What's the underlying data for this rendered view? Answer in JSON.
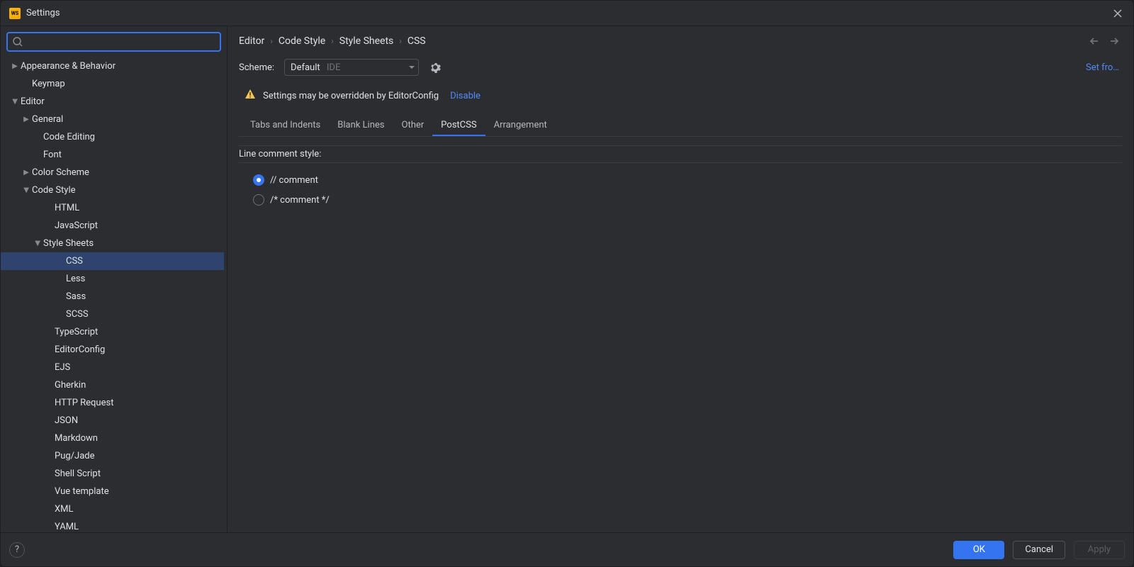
{
  "title": "Settings",
  "search_placeholder": "",
  "tree": [
    {
      "label": "Appearance & Behavior",
      "indent": 12,
      "arrow": "collapsed"
    },
    {
      "label": "Keymap",
      "indent": 28,
      "arrow": "none"
    },
    {
      "label": "Editor",
      "indent": 12,
      "arrow": "expanded"
    },
    {
      "label": "General",
      "indent": 28,
      "arrow": "collapsed"
    },
    {
      "label": "Code Editing",
      "indent": 44,
      "arrow": "none"
    },
    {
      "label": "Font",
      "indent": 44,
      "arrow": "none"
    },
    {
      "label": "Color Scheme",
      "indent": 28,
      "arrow": "collapsed"
    },
    {
      "label": "Code Style",
      "indent": 28,
      "arrow": "expanded"
    },
    {
      "label": "HTML",
      "indent": 60,
      "arrow": "none"
    },
    {
      "label": "JavaScript",
      "indent": 60,
      "arrow": "none"
    },
    {
      "label": "Style Sheets",
      "indent": 44,
      "arrow": "expanded"
    },
    {
      "label": "CSS",
      "indent": 76,
      "arrow": "none",
      "selected": true
    },
    {
      "label": "Less",
      "indent": 76,
      "arrow": "none"
    },
    {
      "label": "Sass",
      "indent": 76,
      "arrow": "none"
    },
    {
      "label": "SCSS",
      "indent": 76,
      "arrow": "none"
    },
    {
      "label": "TypeScript",
      "indent": 60,
      "arrow": "none"
    },
    {
      "label": "EditorConfig",
      "indent": 60,
      "arrow": "none"
    },
    {
      "label": "EJS",
      "indent": 60,
      "arrow": "none"
    },
    {
      "label": "Gherkin",
      "indent": 60,
      "arrow": "none"
    },
    {
      "label": "HTTP Request",
      "indent": 60,
      "arrow": "none"
    },
    {
      "label": "JSON",
      "indent": 60,
      "arrow": "none"
    },
    {
      "label": "Markdown",
      "indent": 60,
      "arrow": "none"
    },
    {
      "label": "Pug/Jade",
      "indent": 60,
      "arrow": "none"
    },
    {
      "label": "Shell Script",
      "indent": 60,
      "arrow": "none"
    },
    {
      "label": "Vue template",
      "indent": 60,
      "arrow": "none"
    },
    {
      "label": "XML",
      "indent": 60,
      "arrow": "none"
    },
    {
      "label": "YAML",
      "indent": 60,
      "arrow": "none"
    }
  ],
  "breadcrumb": [
    "Editor",
    "Code Style",
    "Style Sheets",
    "CSS"
  ],
  "scheme": {
    "label": "Scheme:",
    "name": "Default",
    "suffix": "IDE"
  },
  "set_from": "Set fro…",
  "warning": {
    "text": "Settings may be overridden by EditorConfig",
    "action": "Disable"
  },
  "tabs": [
    "Tabs and Indents",
    "Blank Lines",
    "Other",
    "PostCSS",
    "Arrangement"
  ],
  "active_tab": "PostCSS",
  "section_header": "Line comment style:",
  "radio_options": [
    {
      "label": "// comment",
      "selected": true
    },
    {
      "label": "/* comment */",
      "selected": false
    }
  ],
  "buttons": {
    "ok": "OK",
    "cancel": "Cancel",
    "apply": "Apply"
  }
}
